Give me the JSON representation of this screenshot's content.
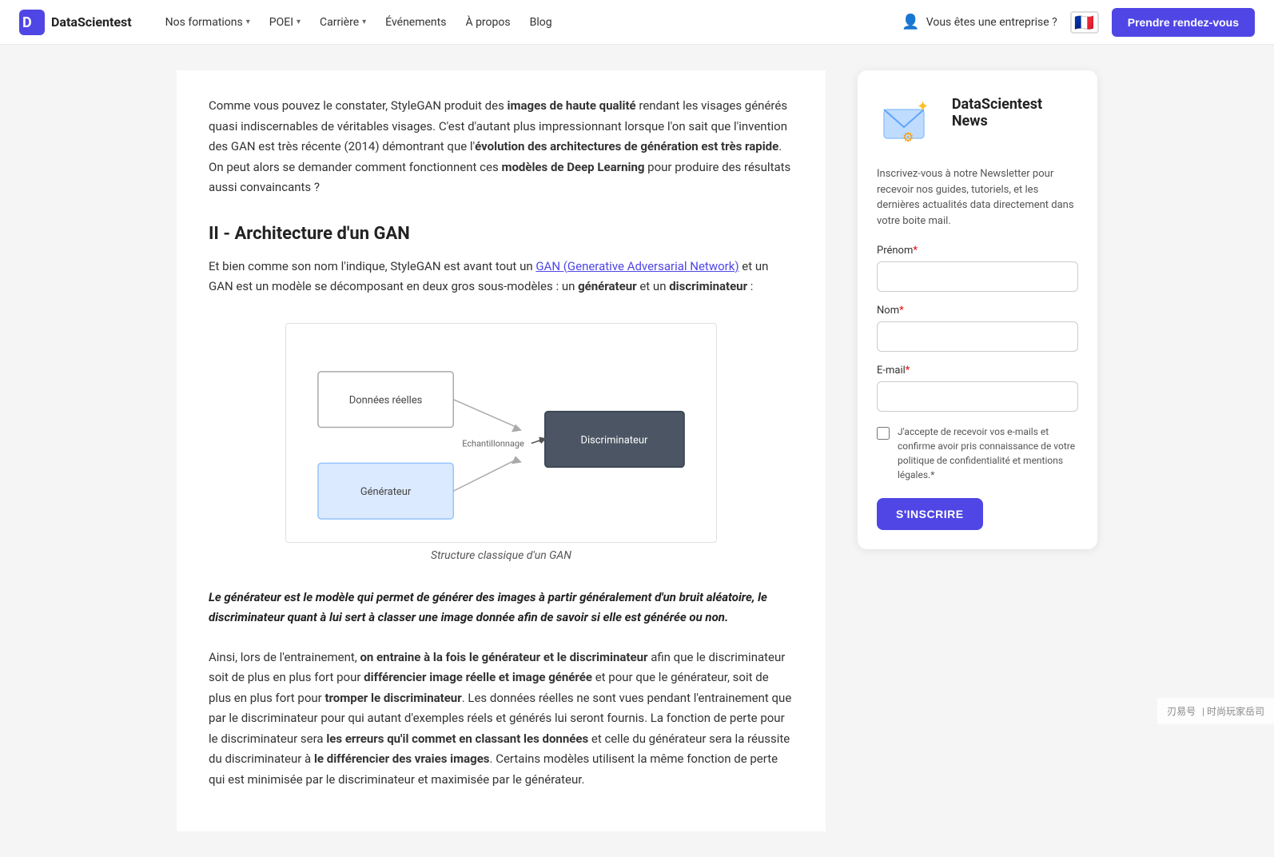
{
  "navbar": {
    "logo_text": "DataScientest",
    "nav_items": [
      {
        "label": "Nos formations",
        "has_dropdown": true
      },
      {
        "label": "POEI",
        "has_dropdown": true
      },
      {
        "label": "Carrière",
        "has_dropdown": true
      },
      {
        "label": "Événements",
        "has_dropdown": false
      },
      {
        "label": "À propos",
        "has_dropdown": false
      },
      {
        "label": "Blog",
        "has_dropdown": false
      }
    ],
    "enterprise_label": "Vous êtes une entreprise ?",
    "cta_label": "Prendre rendez-vous",
    "flag_emoji": "🇫🇷"
  },
  "article": {
    "para1_text": "Comme vous pouvez le constater, StyleGAN produit des ",
    "para1_bold1": "images de haute qualité",
    "para1_rest": " rendant les visages générés quasi indiscernables de véritables visages. C'est d'autant plus impressionnant lorsque l'on sait que l'invention des GAN est très récente (2014) démontrant que l'",
    "para1_bold2": "évolution des architectures de génération est très rapide",
    "para1_end": ". On peut alors se demander comment fonctionnent ces ",
    "para1_bold3": "modèles de Deep Learning",
    "para1_last": " pour produire des résultats aussi convaincants ?",
    "section2_heading": "II - Architecture d'un GAN",
    "section2_intro": "Et bien comme son nom l'indique, StyleGAN est avant tout un ",
    "section2_link_text": "GAN (Generative Adversarial Network)",
    "section2_link_href": "#",
    "section2_after_link": " et un GAN est un modèle se décomposant en deux gros sous-modèles : un ",
    "section2_bold1": "générateur",
    "section2_mid": " et un ",
    "section2_bold2": "discriminateur",
    "section2_colon": " :",
    "diagram_caption": "Structure classique d'un GAN",
    "diagram_labels": {
      "donnees_reelles": "Données réelles",
      "echantillonnage": "Echantillonnage",
      "discriminateur": "Discriminateur",
      "generateur": "Générateur"
    },
    "blockquote": "Le générateur est le modèle qui permet de générer des images à partir généralement d'un bruit aléatoire, le discriminateur quant à lui sert à classer une image donnée afin de savoir si elle est générée ou non.",
    "para3_start": "Ainsi, lors de l'entrainement, ",
    "para3_bold1": "on entraine à la fois le générateur et le discriminateur",
    "para3_mid1": " afin que le discriminateur soit de plus en plus fort pour ",
    "para3_bold2": "différencier image réelle et image générée",
    "para3_mid2": " et pour que le générateur, soit de plus en plus fort pour ",
    "para3_bold3": "tromper le discriminateur",
    "para3_mid3": ". Les données réelles ne sont vues pendant l'entrainement que par le discriminateur pour qui autant d'exemples réels et générés lui seront fournis. La fonction de perte pour le discriminateur sera ",
    "para3_bold4": "les erreurs qu'il commet en classant les données",
    "para3_mid4": " et celle du générateur sera la réussite du discriminateur à ",
    "para3_bold5": "le différencier des vraies images",
    "para3_end": ". Certains modèles utilisent la même fonction de perte qui est minimisée par le discriminateur et maximisée par le générateur."
  },
  "sidebar": {
    "card_title": "DataScientest News",
    "card_desc": "Inscrivez-vous à notre Newsletter pour recevoir nos guides, tutoriels, et les dernières actualités data directement dans votre boite mail.",
    "form": {
      "prenom_label": "Prénom",
      "prenom_required": "*",
      "nom_label": "Nom",
      "nom_required": "*",
      "email_label": "E-mail",
      "email_required": "*",
      "checkbox_text": "J'accepte de recevoir vos e-mails et confirme avoir pris connaissance de votre politique de confidentialité et mentions légales.",
      "checkbox_required": "*",
      "submit_label": "S'INSCRIRE"
    }
  },
  "watermark": {
    "text1": "刃易号",
    "text2": "| 时尚玩家岳司"
  }
}
